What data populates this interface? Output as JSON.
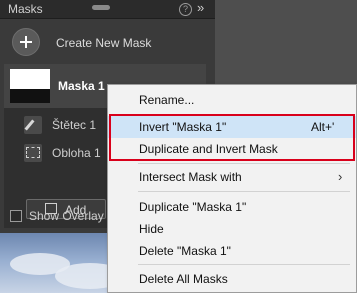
{
  "panel": {
    "title": "Masks",
    "create_label": "Create New Mask",
    "mask_name": "Maska 1",
    "components": [
      "Štětec 1",
      "Obloha 1"
    ],
    "add_label": "Add",
    "overlay_label": "Show Overlay"
  },
  "menu": {
    "items": {
      "rename": "Rename...",
      "invert": "Invert \"Maska 1\"",
      "invert_shortcut": "Alt+'",
      "dup_invert": "Duplicate and Invert Mask",
      "intersect": "Intersect Mask with",
      "duplicate": "Duplicate \"Maska 1\"",
      "hide": "Hide",
      "delete": "Delete \"Maska 1\"",
      "delete_all": "Delete All Masks"
    }
  },
  "colors": {
    "highlight": "#cfe4f7",
    "callout": "#d9001b",
    "panel_bg": "#3a3a3a"
  }
}
